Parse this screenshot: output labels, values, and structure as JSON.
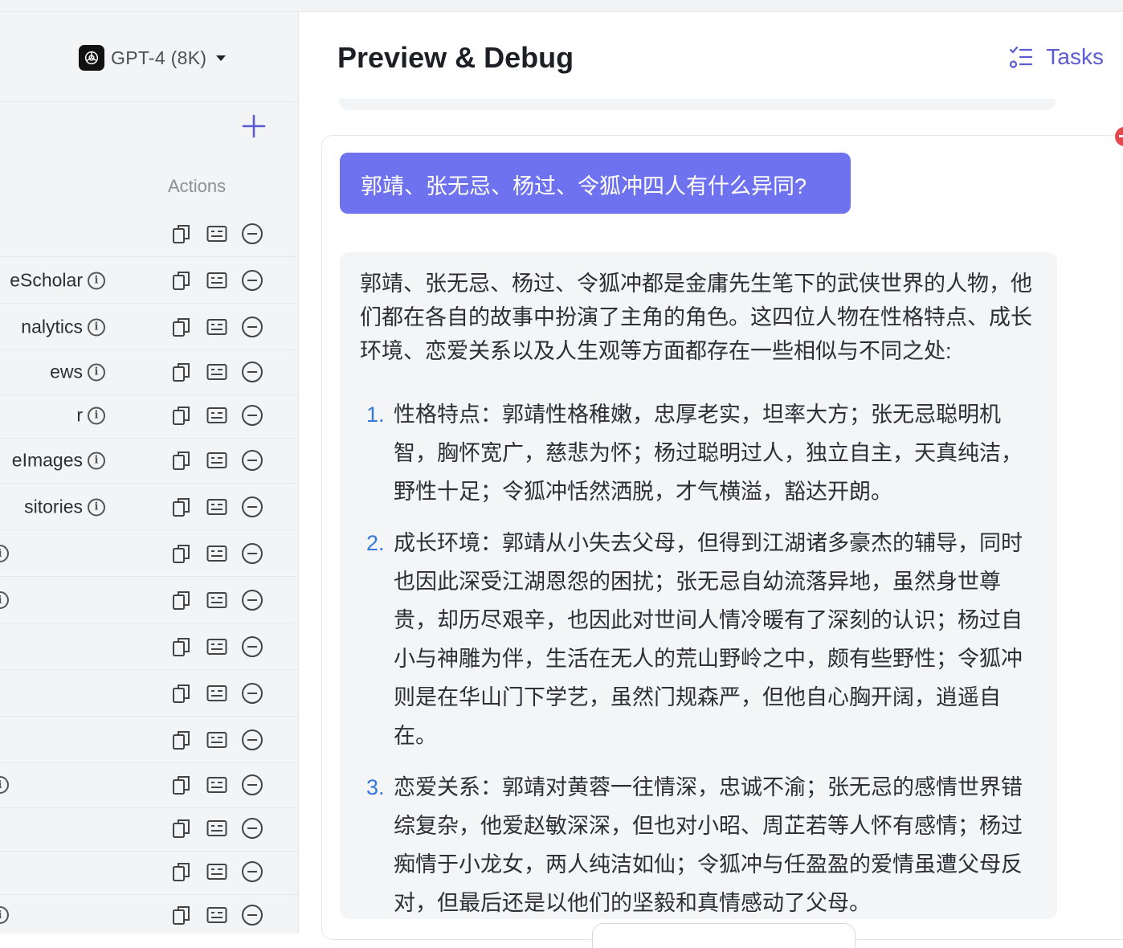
{
  "model": {
    "name": "GPT-4 (8K)",
    "icon": "openai-logo-icon"
  },
  "table": {
    "actions_header": "Actions",
    "rows": [
      {
        "name": "",
        "has_info": false
      },
      {
        "name": "eScholar",
        "has_info": true
      },
      {
        "name": "nalytics",
        "has_info": true
      },
      {
        "name": "ews",
        "has_info": true
      },
      {
        "name": "r",
        "has_info": true
      },
      {
        "name": "eImages",
        "has_info": true
      },
      {
        "name": "sitories",
        "has_info": true
      },
      {
        "name": "",
        "has_info": true
      },
      {
        "name": "",
        "has_info": true
      },
      {
        "name": "",
        "has_info": false
      },
      {
        "name": "",
        "has_info": false
      },
      {
        "name": "",
        "has_info": false
      },
      {
        "name": "",
        "has_info": true
      },
      {
        "name": "",
        "has_info": false
      },
      {
        "name": "",
        "has_info": false
      },
      {
        "name": "",
        "has_info": true
      }
    ],
    "row_icons": [
      "copy-icon",
      "card-icon",
      "remove-icon"
    ]
  },
  "preview": {
    "title": "Preview & Debug",
    "tasks_label": "Tasks"
  },
  "chat": {
    "user_message": "郭靖、张无忌、杨过、令狐冲四人有什么异同?",
    "answer_intro": "郭靖、张无忌、杨过、令狐冲都是金庸先生笔下的武侠世界的人物，他们都在各自的故事中扮演了主角的角色。这四位人物在性格特点、成长环境、恋爱关系以及人生观等方面都存在一些相似与不同之处:",
    "answer_items": [
      {
        "num": "1.",
        "text": "性格特点：郭靖性格稚嫩，忠厚老实，坦率大方；张无忌聪明机智，胸怀宽广，慈悲为怀；杨过聪明过人，独立自主，天真纯洁，野性十足；令狐冲恬然洒脱，才气横溢，豁达开朗。"
      },
      {
        "num": "2.",
        "text": "成长环境：郭靖从小失去父母，但得到江湖诸多豪杰的辅导，同时也因此深受江湖恩怨的困扰；张无忌自幼流落异地，虽然身世尊贵，却历尽艰辛，也因此对世间人情冷暖有了深刻的认识；杨过自小与神雕为伴，生活在无人的荒山野岭之中，颇有些野性；令狐冲则是在华山门下学艺，虽然门规森严，但他自心胸开阔，逍遥自在。"
      },
      {
        "num": "3.",
        "text": "恋爱关系：郭靖对黄蓉一往情深，忠诚不渝；张无忌的感情世界错综复杂，他爱赵敏深深，但也对小昭、周芷若等人怀有感情；杨过痴情于小龙女，两人纯洁如仙；令狐冲与任盈盈的爱情虽遭父母反对，但最后还是以他们的坚毅和真情感动了父母。"
      }
    ]
  },
  "colors": {
    "accent": "#6f72ef",
    "link": "#5b5bd6",
    "alert": "#e5484d"
  }
}
